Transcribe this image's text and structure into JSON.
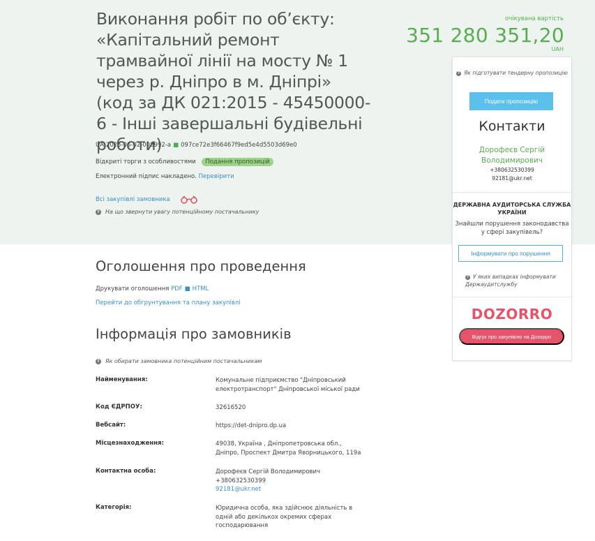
{
  "header": {
    "title": "Виконання робіт по об’єкту: «Капітальний ремонт трамвайної лінії на мосту № 1 через р. Дніпро в м. Дніпрі» (код за ДК 021:2015 - 45450000-6 - Інші завершальні будівельні роботи)",
    "tender_id": "UA-2025-06-02-008992-a",
    "tender_hash": "097ce72e3f66467f9ed5e4d5503d69e0",
    "separator": "■",
    "procedure": "Відкриті торги з особливостями",
    "status_badge": "Подання пропозицій",
    "signature_text": "Електронний підпис накладено.",
    "verify_link": "Перевірити",
    "all_purchases_link": "Всі закупівлі замовника",
    "supplier_hint": "На що звернути увагу потенційному постачальнику"
  },
  "price": {
    "label": "очікувана вартість",
    "amount": "351 280 351,20",
    "currency": "UAH"
  },
  "sidebar": {
    "bid_hint": "Як підготувати тендерну пропозицію",
    "bid_button": "Подати пропозицію",
    "contacts_title": "Контакти",
    "contact_name": "Дорофеєв Сергій Володимирович",
    "contact_phone": "+380632530399",
    "contact_email": "92181@ukr.net",
    "audit_title": "ДЕРЖАВНА АУДИТОРСЬКА СЛУЖБА УКРАЇНИ",
    "audit_text": "Знайшли порушення законодавства у сфері закупівель?",
    "report_button": "Інформувати про порушення",
    "audit_hint": "У яких випадках інформувати Держаудитслужбу",
    "dozorro_logo": "DOZORRO",
    "dozorro_button": "Відгук про закупівлю на Дозорро"
  },
  "announcement": {
    "title": "Оголошення про проведення",
    "print_label": "Друкувати оголошення",
    "pdf_link": "PDF",
    "html_link": "HTML",
    "separator": "■",
    "justification_link": "Перейти до обгрунтування та плану закупівлі"
  },
  "customers": {
    "title": "Інформація про замовників",
    "hint": "Як обирати замовника потенційним постачальникам",
    "rows": [
      {
        "label": "Найменування:",
        "value": "Комунальне підприємство \"Дніпровський електротранспорт\" Дніпровської міської ради"
      },
      {
        "label": "Код ЄДРПОУ:",
        "value": "32616520"
      },
      {
        "label": "Вебсайт:",
        "value": "https://det-dnipro.dp.ua"
      },
      {
        "label": "Місцезнаходження:",
        "value": "49038, Україна , Дніпропетровська обл., Дніпро, Проспект Дмитра Яворницького, 119а"
      },
      {
        "label": "Контактна особа:",
        "value_name": "Дорофеєв Сергій Володимирович",
        "value_phone": "+380632530399",
        "value_email": "92181@ukr.net"
      },
      {
        "label": "Категорія:",
        "value": "Юридична особа, яка здійснює діяльність в одній або декількох окремих сферах господарювання"
      }
    ]
  },
  "colors": {
    "accent_green": "#5aac52",
    "link_blue": "#3a8fc9",
    "bid_button": "#5bc0eb",
    "dozorro_red": "#e5546a",
    "header_bg": "#edf3ee"
  }
}
